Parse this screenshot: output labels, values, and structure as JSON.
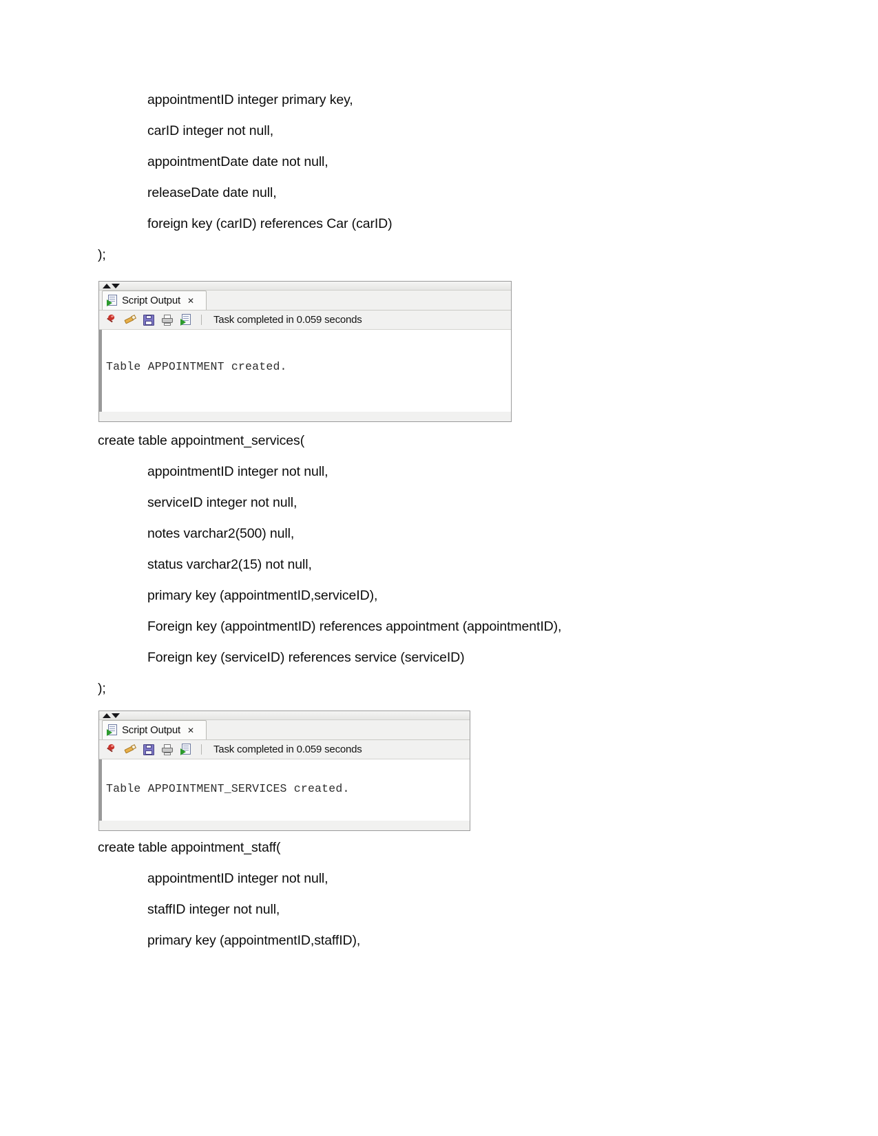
{
  "document": {
    "blocks": [
      {
        "kind": "text",
        "indent": true,
        "text": "appointmentID integer primary key,"
      },
      {
        "kind": "text",
        "indent": true,
        "text": "carID integer not null,"
      },
      {
        "kind": "text",
        "indent": true,
        "text": "appointmentDate date not null,"
      },
      {
        "kind": "text",
        "indent": true,
        "text": "releaseDate date null,"
      },
      {
        "kind": "text",
        "indent": true,
        "text": "foreign key (carID) references Car (carID)"
      },
      {
        "kind": "text",
        "indent": false,
        "text": ");"
      },
      {
        "kind": "text",
        "indent": false,
        "text": "create table appointment_services("
      },
      {
        "kind": "text",
        "indent": true,
        "text": "appointmentID integer not null,"
      },
      {
        "kind": "text",
        "indent": true,
        "text": "serviceID integer not null,"
      },
      {
        "kind": "text",
        "indent": true,
        "text": "notes varchar2(500) null,"
      },
      {
        "kind": "text",
        "indent": true,
        "text": "status varchar2(15) not null,"
      },
      {
        "kind": "text",
        "indent": true,
        "text": "primary key (appointmentID,serviceID),"
      },
      {
        "kind": "text",
        "indent": true,
        "text": "Foreign key (appointmentID) references appointment (appointmentID),"
      },
      {
        "kind": "text",
        "indent": true,
        "text": "Foreign key (serviceID) references service (serviceID)"
      },
      {
        "kind": "text",
        "indent": false,
        "text": ");"
      },
      {
        "kind": "text",
        "indent": false,
        "text": "create table appointment_staff("
      },
      {
        "kind": "text",
        "indent": true,
        "text": "appointmentID integer not null,"
      },
      {
        "kind": "text",
        "indent": true,
        "text": "staffID integer not null,"
      },
      {
        "kind": "text",
        "indent": true,
        "text": "primary key (appointmentID,staffID),"
      }
    ],
    "lines": {
      "l1": "appointmentID integer primary key,",
      "l2": "carID integer not null,",
      "l3": "appointmentDate date not null,",
      "l4": "releaseDate date null,",
      "l5": "foreign key (carID) references Car (carID)",
      "l6": ");",
      "l7": "create table appointment_services(",
      "l8": "appointmentID integer not null,",
      "l9": "serviceID integer not null,",
      "l10": "notes varchar2(500) null,",
      "l11": "status varchar2(15) not null,",
      "l12": "primary key (appointmentID,serviceID),",
      "l13": "Foreign key (appointmentID) references appointment (appointmentID),",
      "l14": "Foreign key (serviceID) references service (serviceID)",
      "l15": ");",
      "l16": "create table appointment_staff(",
      "l17": "appointmentID integer not null,",
      "l18": "staffID integer not null,",
      "l19": "primary key (appointmentID,staffID),"
    }
  },
  "script_output_1": {
    "tab_label": "Script Output",
    "tab_close": "✕",
    "tab_icon": "script-output-icon",
    "toolbar": {
      "pin_icon": "pushpin-icon",
      "clear_icon": "eraser-icon",
      "save_icon": "floppy-save-icon",
      "print_icon": "printer-icon",
      "run_icon": "run-script-icon"
    },
    "status": "Task completed in 0.059 seconds",
    "output": "Table APPOINTMENT created."
  },
  "script_output_2": {
    "tab_label": "Script Output",
    "tab_close": "✕",
    "tab_icon": "script-output-icon",
    "toolbar": {
      "pin_icon": "pushpin-icon",
      "clear_icon": "eraser-icon",
      "save_icon": "floppy-save-icon",
      "print_icon": "printer-icon",
      "run_icon": "run-script-icon"
    },
    "status": "Task completed in 0.059 seconds",
    "output": "Table APPOINTMENT_SERVICES created."
  },
  "colors": {
    "page_background": "#ffffff",
    "body_text": "#0c0c0c",
    "panel_chrome": "#f1f1f0",
    "panel_border": "#9a9a9a",
    "output_text": "#2d2d2d",
    "accent_green": "#2c9b2c",
    "accent_red": "#c8322a",
    "accent_purple": "#7c76c4",
    "accent_amber": "#e8b04a"
  }
}
